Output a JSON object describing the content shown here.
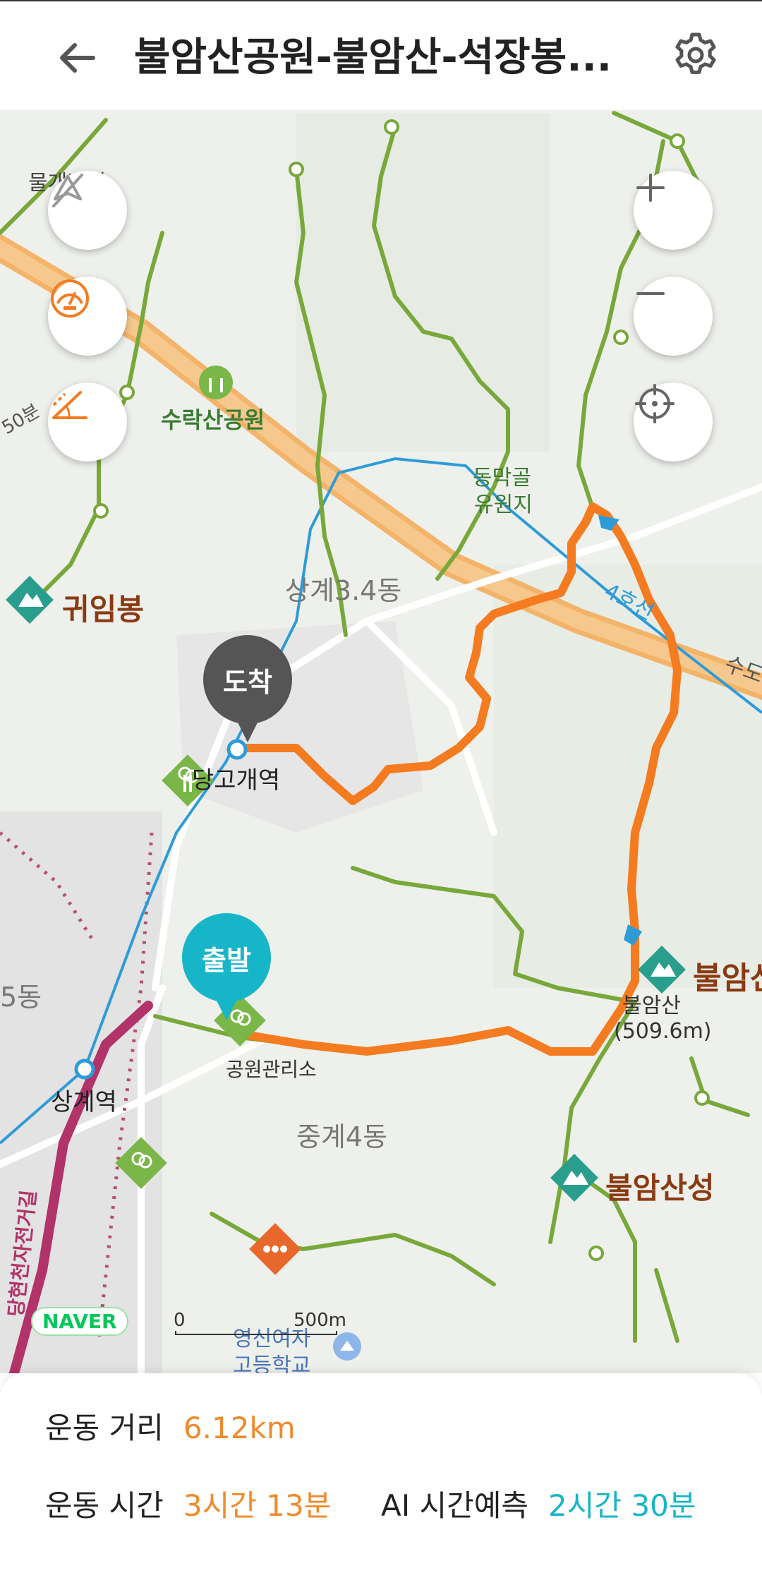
{
  "header": {
    "title": "불암산공원-불암산-석장봉...",
    "back_icon": "arrow-left-icon",
    "settings_icon": "gear-icon"
  },
  "map": {
    "controls": {
      "compass_off_icon": "compass-off-icon",
      "speed_icon": "speedometer-icon",
      "slope_icon": "slope-icon",
      "zoom_in_icon": "plus-icon",
      "zoom_out_icon": "minus-icon",
      "locate_icon": "crosshair-icon"
    },
    "labels": {
      "top_left_partial": "물개바위",
      "park": "수락산공원",
      "trail_time": "50분",
      "donggol": "동막골",
      "yuwonji": "유원지",
      "sanggye34": "상계3.4동",
      "gwimbong": "귀임봉",
      "line4": "4호선",
      "sudo": "수도",
      "danggogae": "당고개역",
      "bulamsan_peak": "불암산",
      "bulamsan_name": "불암산",
      "bulamsan_height": "(509.6m)",
      "dong_left": "5동",
      "park_office": "공원관리소",
      "sanggye_station": "상계역",
      "junggye4": "중계4동",
      "bulamsanseong": "불암산성",
      "road_vertical": "당현천자전거길",
      "school_1": "영신여자",
      "school_2": "고등학교"
    },
    "markers": {
      "arrival": "도착",
      "start": "출발"
    },
    "scale": {
      "zero": "0",
      "distance": "500m"
    },
    "brand": "NAVER",
    "colors": {
      "route": "#f47b20",
      "trail": "#78a83a",
      "subway": "#2e9bd8",
      "highway": "#f3b46a",
      "teal": "#17b5c8",
      "peak": "#2a9e8d"
    }
  },
  "stats": {
    "distance_label": "운동 거리",
    "distance_value": "6.12km",
    "time_label": "운동 시간",
    "time_value": "3시간 13분",
    "ai_label": "AI 시간예측",
    "ai_value": "2시간 30분"
  }
}
